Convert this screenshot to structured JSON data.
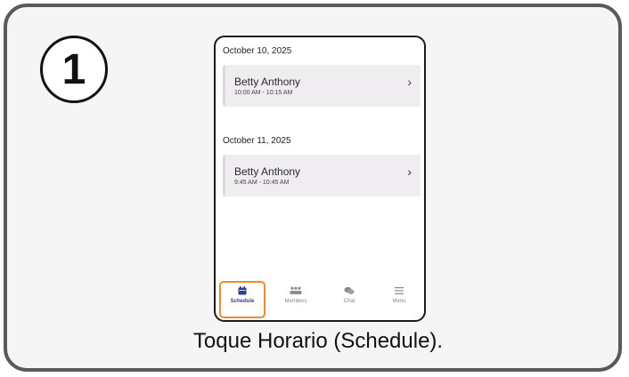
{
  "step": {
    "number": "1"
  },
  "schedule": {
    "groups": [
      {
        "date": "October 10, 2025",
        "appointments": [
          {
            "name": "Betty Anthony",
            "time": "10:00 AM - 10:15 AM"
          }
        ]
      },
      {
        "date": "October 11, 2025",
        "appointments": [
          {
            "name": "Betty Anthony",
            "time": "9:45 AM - 10:45 AM"
          }
        ]
      }
    ]
  },
  "tabs": [
    {
      "label": "Schedule",
      "icon": "calendar-icon",
      "active": true
    },
    {
      "label": "Members",
      "icon": "members-icon",
      "active": false
    },
    {
      "label": "Chat",
      "icon": "chat-icon",
      "active": false
    },
    {
      "label": "Menu",
      "icon": "hamburger-menu-icon",
      "active": false
    }
  ],
  "colors": {
    "highlight": "#f08a2c",
    "active_tab": "#2d3f8f",
    "card_border": "#5a5a5a"
  },
  "caption": "Toque Horario (Schedule)."
}
